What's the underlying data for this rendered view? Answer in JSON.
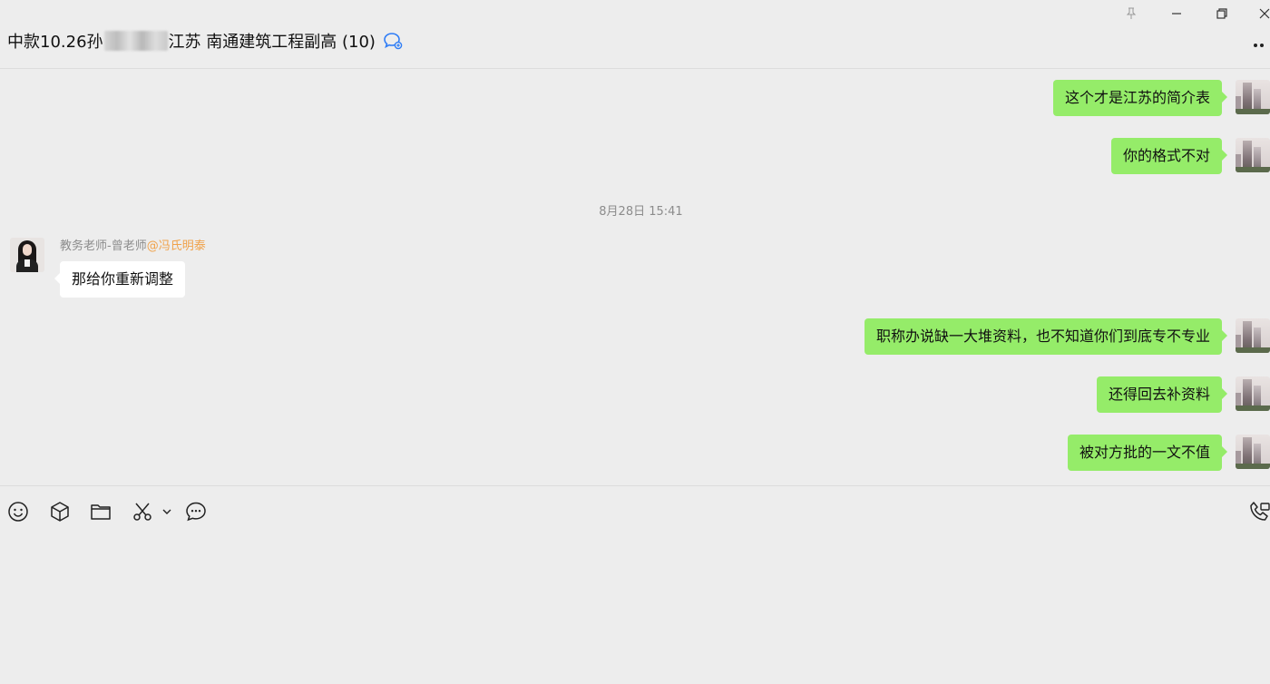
{
  "window": {
    "controls": [
      "pin-icon",
      "minimize-icon",
      "restore-icon",
      "close-icon"
    ]
  },
  "header": {
    "title_prefix": "中款10.26孙",
    "title_suffix": "江苏 南通建筑工程副高 (10)",
    "more_icon": "more-dots-icon",
    "group_icon": "group-chat-icon"
  },
  "messages": [
    {
      "side": "right",
      "text": "这个才是江苏的简介表"
    },
    {
      "side": "right",
      "text": "你的格式不对"
    },
    {
      "type": "timestamp",
      "text": "8月28日 15:41"
    },
    {
      "side": "left",
      "sender": "教务老师-曾老师",
      "mention": "@冯氏明泰",
      "text": "那给你重新调整"
    },
    {
      "side": "right",
      "text": "职称办说缺一大堆资料，也不知道你们到底专不专业"
    },
    {
      "side": "right",
      "text": "还得回去补资料"
    },
    {
      "side": "right",
      "text": "被对方批的一文不值"
    }
  ],
  "toolbar": {
    "icons": [
      "emoji-icon",
      "box-icon",
      "folder-icon",
      "scissors-icon",
      "chevron-down-icon",
      "chat-bubble-icon",
      "phone-icon"
    ]
  },
  "colors": {
    "background": "#ededed",
    "self_bubble": "#95ec69",
    "other_bubble": "#ffffff",
    "mention": "#f0a24a",
    "meta_text": "#8c8c8c"
  }
}
